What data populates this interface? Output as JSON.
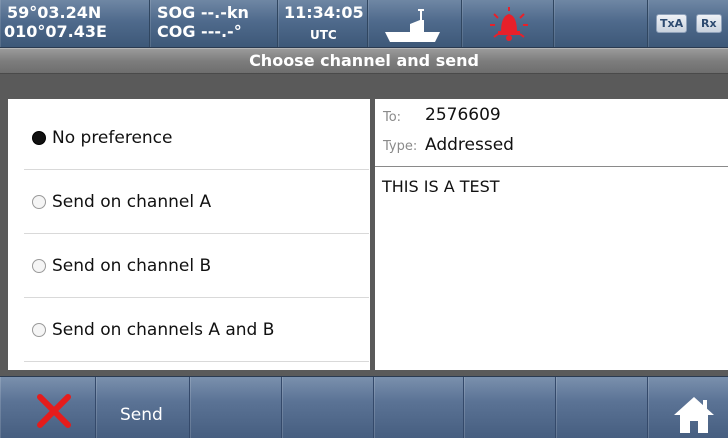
{
  "status_bar": {
    "latitude": "59°03.24N",
    "longitude": "010°07.43E",
    "sog": "SOG --.-kn",
    "cog": "COG ---.-°",
    "time": "11:34:05",
    "timezone": "UTC",
    "tx_label": "TxA",
    "rx_label": "Rx",
    "icons": [
      "vessel-icon",
      "alarm-bell-icon"
    ]
  },
  "title": "Choose channel and send",
  "channel_options": [
    {
      "label": "No preference",
      "selected": true
    },
    {
      "label": "Send on channel A",
      "selected": false
    },
    {
      "label": "Send on channel B",
      "selected": false
    },
    {
      "label": "Send on channels A and B",
      "selected": false
    }
  ],
  "message": {
    "to_label": "To:",
    "to_value": "2576609",
    "type_label": "Type:",
    "type_value": "Addressed",
    "body": "THIS IS A TEST"
  },
  "bottom_bar": {
    "cancel_icon": "close-icon",
    "send_label": "Send",
    "home_icon": "home-icon"
  },
  "colors": {
    "bar_blue": "#4f6a8c",
    "alarm_red": "#e8202a",
    "cancel_red": "#e51c1c"
  }
}
